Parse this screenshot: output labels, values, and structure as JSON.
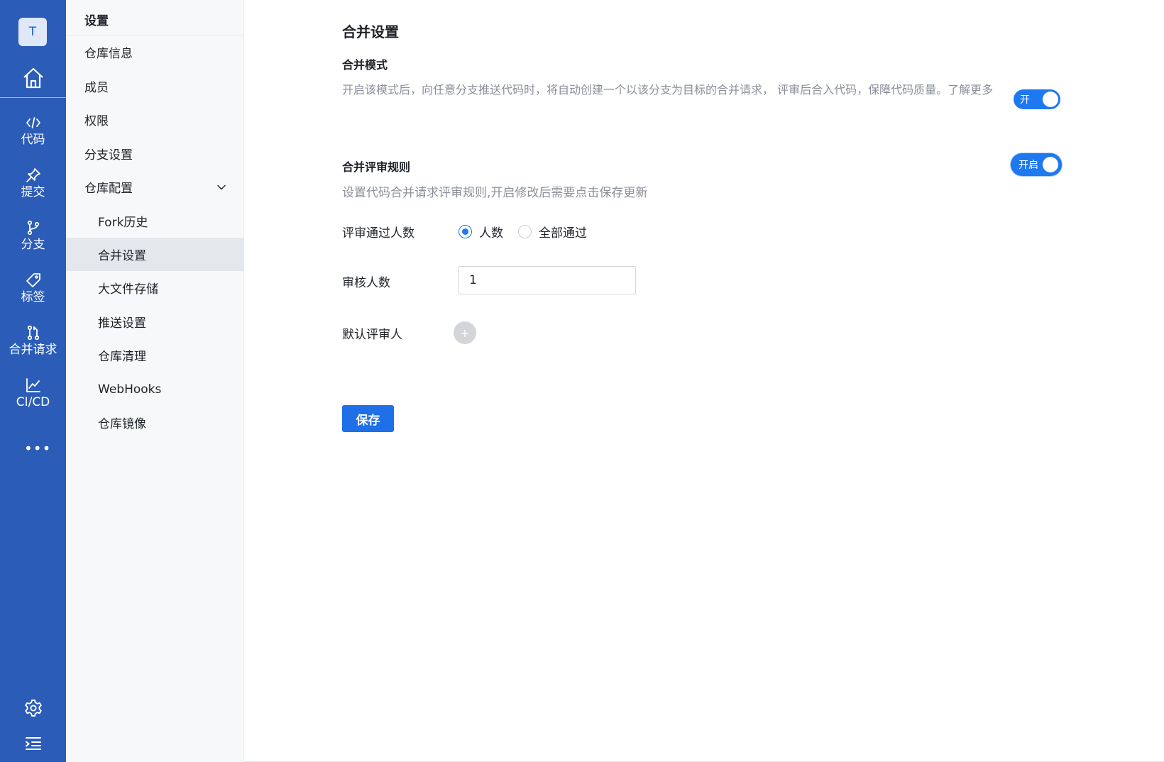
{
  "rail": {
    "avatar_initial": "T",
    "items": [
      {
        "label": "代码",
        "icon": "code-icon"
      },
      {
        "label": "提交",
        "icon": "pin-icon"
      },
      {
        "label": "分支",
        "icon": "branch-icon"
      },
      {
        "label": "标签",
        "icon": "tag-icon"
      },
      {
        "label": "合并请求",
        "icon": "merge-request-icon"
      },
      {
        "label": "CI/CD",
        "icon": "chart-line-icon"
      }
    ],
    "more_label": "•••"
  },
  "menu": {
    "title": "设置",
    "items": [
      {
        "label": "仓库信息"
      },
      {
        "label": "成员"
      },
      {
        "label": "权限"
      },
      {
        "label": "分支设置"
      },
      {
        "label": "仓库配置"
      }
    ],
    "sub_items": [
      {
        "label": "Fork历史"
      },
      {
        "label": "合并设置"
      },
      {
        "label": "大文件存储"
      },
      {
        "label": "推送设置"
      },
      {
        "label": "仓库清理"
      },
      {
        "label": "WebHooks"
      },
      {
        "label": "仓库镜像"
      }
    ],
    "active": "合并设置"
  },
  "main": {
    "page_title": "合并设置",
    "merge_mode": {
      "title": "合并模式",
      "description": "开启该模式后，向任意分支推送代码时，将自动创建一个以该分支为目标的合并请求， 评审后合入代码，保障代码质量。了解更多",
      "toggle_label": "开",
      "enabled": true
    },
    "review_rules": {
      "title": "合并评审规则",
      "description": "设置代码合并请求评审规则,开启修改后需要点击保存更新",
      "toggle_label": "开启",
      "enabled": true
    },
    "pass_count": {
      "label": "评审通过人数",
      "options": [
        "人数",
        "全部通过"
      ],
      "selected": "人数"
    },
    "reviewer_count": {
      "label": "审核人数",
      "value": "1"
    },
    "default_reviewer": {
      "label": "默认评审人",
      "add_symbol": "+"
    },
    "save_label": "保存"
  },
  "colors": {
    "rail_bg": "#2b5cb8",
    "accent": "#1e78f0",
    "menu_bg": "#f7f8fa",
    "active_bg": "#e4e7ec",
    "muted_text": "#8a8f99"
  }
}
